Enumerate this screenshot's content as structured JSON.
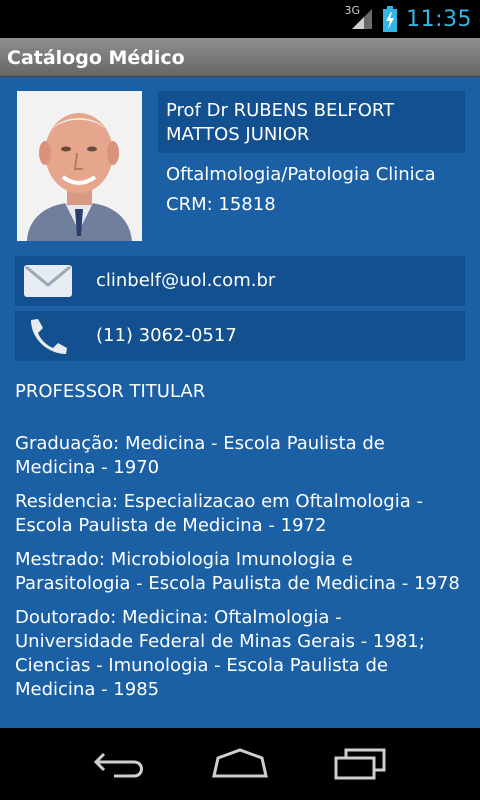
{
  "status": {
    "network": "3G",
    "time": "11:35"
  },
  "app": {
    "title": "Catálogo Médico"
  },
  "doctor": {
    "name": "Prof  Dr  RUBENS BELFORT MATTOS JUNIOR",
    "specialty": "Oftalmologia/Patologia Clinica",
    "crm": "CRM: 15818"
  },
  "contact": {
    "email": "clinbelf@uol.com.br",
    "phone": "(11) 3062-0517"
  },
  "profile": {
    "title": "PROFESSOR TITULAR",
    "entries": [
      "Graduação: Medicina - Escola Paulista de Medicina - 1970",
      "Residencia: Especializacao em Oftalmologia - Escola Paulista de Medicina - 1972",
      "Mestrado: Microbiologia Imunologia e Parasitologia - Escola Paulista de Medicina - 1978",
      "Doutorado: Medicina: Oftalmologia - Universidade Federal de Minas Gerais - 1981; Ciencias - Imunologia - Escola Paulista de Medicina - 1985"
    ]
  },
  "icons": {
    "email": "envelope-icon",
    "phone": "phone-icon",
    "back": "back-icon",
    "home": "home-icon",
    "recents": "recent-apps-icon"
  },
  "colors": {
    "background": "#1b5fa4",
    "panel": "#13508f",
    "clock": "#33b5e5"
  }
}
